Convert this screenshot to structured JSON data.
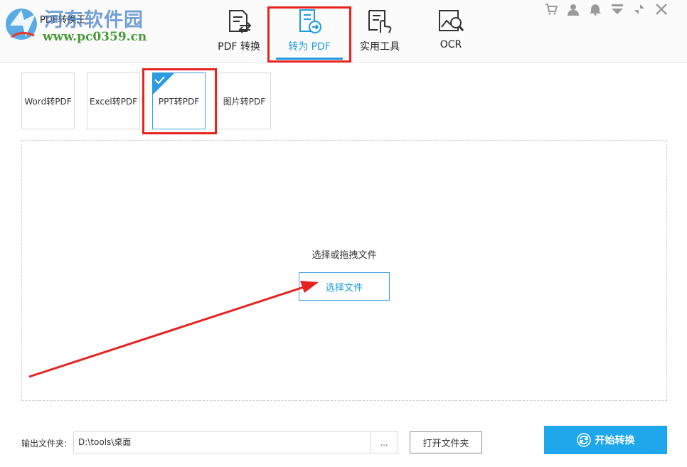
{
  "app": {
    "title": "PDF转换王",
    "watermark_text": "河东软件园",
    "watermark_url": "www.pc0359.cn"
  },
  "nav": {
    "tabs": [
      {
        "label": "PDF 转换",
        "icon": "pdf-convert-icon"
      },
      {
        "label": "转为 PDF",
        "icon": "to-pdf-icon",
        "active": true
      },
      {
        "label": "实用工具",
        "icon": "tools-icon"
      },
      {
        "label": "OCR",
        "icon": "ocr-icon"
      }
    ]
  },
  "toolbar": {
    "icons": [
      "cart-icon",
      "user-icon",
      "bell-icon",
      "menu-icon",
      "minimize-icon",
      "close-icon"
    ]
  },
  "subtabs": {
    "items": [
      {
        "label": "Word转PDF"
      },
      {
        "label": "Excel转PDF"
      },
      {
        "label": "PPT转PDF",
        "selected": true
      },
      {
        "label": "图片转PDF"
      }
    ]
  },
  "dropzone": {
    "hint": "选择或拖拽文件",
    "select_label": "选择文件"
  },
  "output": {
    "label": "输出文件夹:",
    "path": "D:\\tools\\桌面",
    "more_label": "...",
    "open_folder_label": "打开文件夹"
  },
  "start": {
    "label": "开始转换"
  },
  "colors": {
    "accent": "#1e9be0",
    "highlight": "#e52421",
    "start_button": "#1ea7ea"
  }
}
